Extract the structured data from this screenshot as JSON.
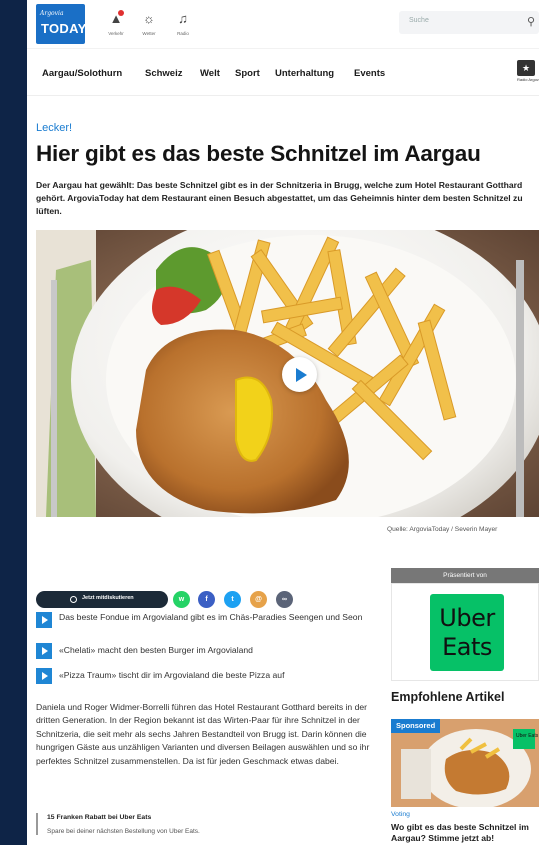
{
  "header": {
    "logo_small": "Argovia",
    "logo_big": "TODAY",
    "icons": [
      {
        "icon": "traffic-icon",
        "label": "Verkehr"
      },
      {
        "icon": "weather-icon",
        "label": "Wetter"
      },
      {
        "icon": "radio-icon",
        "label": "Radio"
      }
    ],
    "search_placeholder": "Suche",
    "radio_logo_label": "Radio Argovia"
  },
  "nav": {
    "items": [
      "Aargau/Solothurn",
      "Schweiz",
      "Welt",
      "Sport",
      "Unterhaltung",
      "Events"
    ]
  },
  "article": {
    "kicker": "Lecker!",
    "title": "Hier gibt es das beste Schnitzel im Aargau",
    "lead": "Der Aargau hat gewählt: Das beste Schnitzel gibt es in der Schnitzeria in Brugg, welche zum Hotel Restaurant Gotthard gehört. ArgoviaToday hat dem Restaurant einen Besuch abgestattet, um das Geheimnis hinter dem besten Schnitzel zu lüften.",
    "image_caption": "Quelle: ArgoviaToday / Severin Mayer",
    "share_label": "Jetzt mitdiskutieren",
    "share_icons": [
      {
        "icon": "whatsapp-icon",
        "color": "#25d366",
        "glyph": "w"
      },
      {
        "icon": "messenger-icon",
        "color": "#3b5fc4",
        "glyph": "f"
      },
      {
        "icon": "twitter-icon",
        "color": "#1da1f2",
        "glyph": "t"
      },
      {
        "icon": "email-icon",
        "color": "#e6a24a",
        "glyph": "@"
      },
      {
        "icon": "link-icon",
        "color": "#5b6478",
        "glyph": "∞"
      }
    ],
    "related": [
      "Das beste Fondue im Argovialand gibt es im Chäs-Paradies Seengen und Seon",
      "«Chelati» macht den besten Burger im Argovialand",
      "«Pizza Traum» tischt dir im Argovialand die beste Pizza auf"
    ],
    "body": "Daniela und Roger Widmer-Borrelli führen das Hotel Restaurant Gotthard bereits in der dritten Generation. In der Region bekannt ist das Wirten-Paar für ihre Schnitzel in der Schnitzeria, die seit mehr als sechs Jahren Bestandteil von Brugg ist. Darin können die hungrigen Gäste aus unzähligen Varianten und diversen Beilagen auswählen und so ihr perfektes Schnitzel zusammenstellen. Da ist für jeden Geschmack etwas dabei.",
    "promo_title": "15 Franken Rabatt bei Uber Eats",
    "promo_sub": "Spare bei deiner nächsten Bestellung von Uber Eats."
  },
  "sidebar": {
    "presented_by": "Präsentiert von",
    "ad_line1": "Uber",
    "ad_line2": "Eats",
    "recommended_title": "Empfohlene Artikel",
    "sponsored_badge": "Sponsored",
    "rec_kicker": "Voting",
    "rec_headline": "Wo gibt es das beste Schnitzel im Aargau? Stimme jetzt ab!",
    "rec_img_logo": "Uber Eats"
  },
  "colors": {
    "accent": "#1a7cd0",
    "dark_bg": "#0e2447",
    "uber_green": "#06c167"
  }
}
